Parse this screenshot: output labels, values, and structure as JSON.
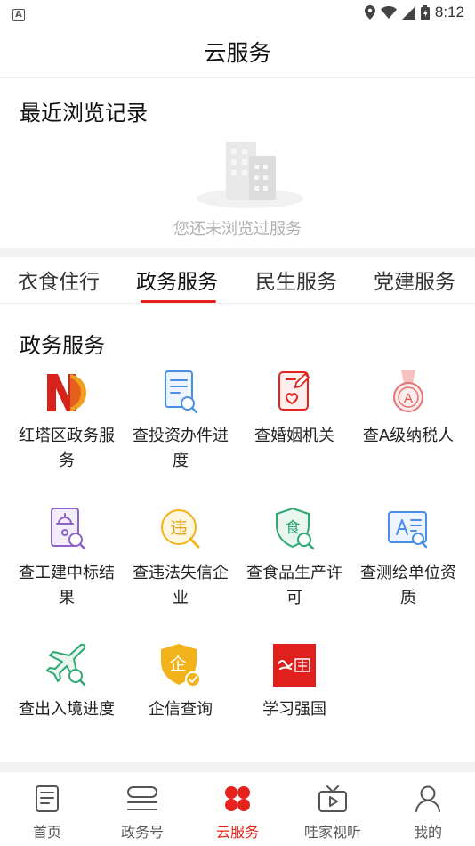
{
  "status": {
    "time": "8:12",
    "notif_letter": "A"
  },
  "header": {
    "title": "云服务"
  },
  "recent": {
    "title": "最近浏览记录",
    "empty_text": "您还未浏览过服务"
  },
  "tabs": [
    {
      "label": "衣食住行"
    },
    {
      "label": "政务服务"
    },
    {
      "label": "民生服务"
    },
    {
      "label": "党建服务"
    }
  ],
  "section": {
    "title": "政务服务"
  },
  "services": [
    {
      "label": "红塔区政务服务",
      "icon": "hongta-logo-icon"
    },
    {
      "label": "查投资办件进度",
      "icon": "document-search-icon"
    },
    {
      "label": "查婚姻机关",
      "icon": "marriage-certificate-icon"
    },
    {
      "label": "查A级纳税人",
      "icon": "medal-a-icon"
    },
    {
      "label": "查工建中标结果",
      "icon": "construction-search-icon"
    },
    {
      "label": "查违法失信企业",
      "icon": "violation-search-icon"
    },
    {
      "label": "查食品生产许可",
      "icon": "food-shield-icon"
    },
    {
      "label": "查测绘单位资质",
      "icon": "surveying-icon"
    },
    {
      "label": "查出入境进度",
      "icon": "airplane-search-icon"
    },
    {
      "label": "企信查询",
      "icon": "enterprise-shield-icon"
    },
    {
      "label": "学习强国",
      "icon": "xuexi-qiangguo-logo-icon"
    }
  ],
  "nav": [
    {
      "label": "首页",
      "icon": "news-icon"
    },
    {
      "label": "政务号",
      "icon": "layers-icon"
    },
    {
      "label": "云服务",
      "icon": "cloud-service-icon"
    },
    {
      "label": "哇家视听",
      "icon": "tv-icon"
    },
    {
      "label": "我的",
      "icon": "user-icon"
    }
  ],
  "colors": {
    "accent": "#e5231c",
    "blue": "#4a8fe7",
    "purple": "#8e63c9",
    "yellow": "#f2b21a",
    "green": "#2fa872"
  }
}
